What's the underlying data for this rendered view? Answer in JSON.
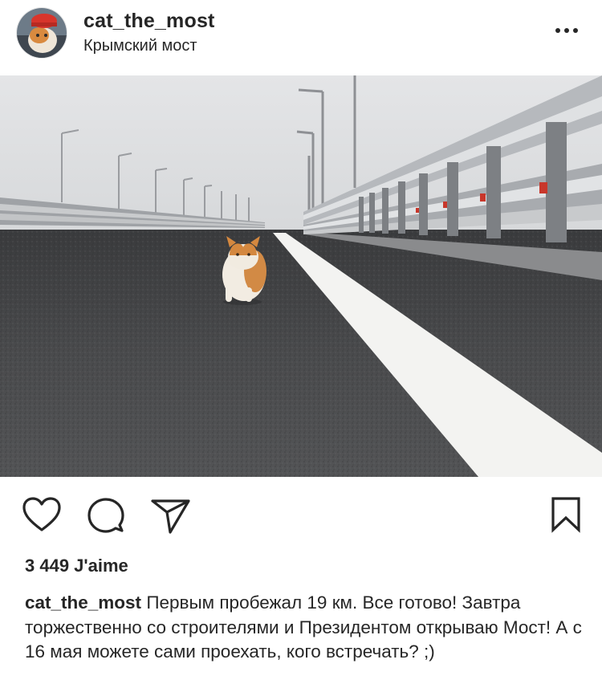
{
  "post": {
    "username": "cat_the_most",
    "location": "Крымский мост",
    "likes": "3 449 J'aime",
    "caption_username": "cat_the_most",
    "caption_text": "Первым пробежал 19 км. Все готово! Завтра торжественно со строителями и Президентом открываю Мост! А с 16 мая можете сами проехать, кого встречать? ;)"
  },
  "icons": {
    "more": "more-options-icon",
    "like": "heart-icon",
    "comment": "comment-icon",
    "share": "paper-plane-icon",
    "save": "bookmark-icon"
  },
  "colors": {
    "text": "#262626",
    "background": "#ffffff"
  }
}
